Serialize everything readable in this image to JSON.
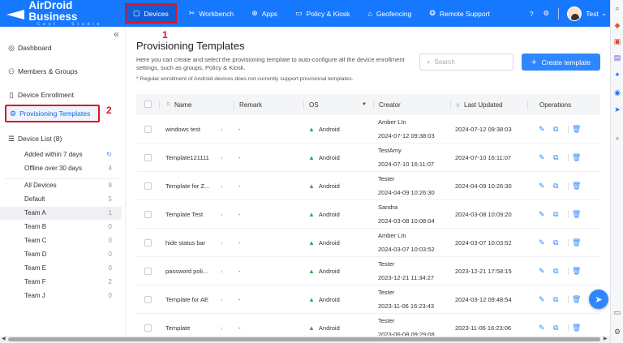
{
  "brand": {
    "name": "AirDroid Business",
    "tagline": "Cast · Studio"
  },
  "top_nav": [
    {
      "label": "Devices",
      "icon": "tablet-icon",
      "glyph": "▢"
    },
    {
      "label": "Workbench",
      "icon": "tools-icon",
      "glyph": "✂"
    },
    {
      "label": "Apps",
      "icon": "bag-icon",
      "glyph": "⊕"
    },
    {
      "label": "Policy & Kiosk",
      "icon": "folder-icon",
      "glyph": "▭"
    },
    {
      "label": "Geofencing",
      "icon": "map-pin-icon",
      "glyph": "⌂"
    },
    {
      "label": "Remote Support",
      "icon": "lifebuoy-icon",
      "glyph": "❂"
    }
  ],
  "user": {
    "name": "Test"
  },
  "annotations": {
    "one": "1",
    "two": "2"
  },
  "sidebar": {
    "dashboard": "Dashboard",
    "members": "Members & Groups",
    "enrollment": "Device Enrollment",
    "provisioning": "Provisioning Templates",
    "device_list": "Device List (8)",
    "filters": [
      {
        "label": "Added within 7 days",
        "count": ""
      },
      {
        "label": "Offline over 30 days",
        "count": "4"
      }
    ],
    "groups": [
      {
        "label": "All Devices",
        "count": "8"
      },
      {
        "label": "Default",
        "count": "5"
      },
      {
        "label": "Team A",
        "count": "1"
      },
      {
        "label": "Team B",
        "count": "0"
      },
      {
        "label": "Team C",
        "count": "0"
      },
      {
        "label": "Team D",
        "count": "0"
      },
      {
        "label": "Team E",
        "count": "0"
      },
      {
        "label": "Team F",
        "count": "2"
      },
      {
        "label": "Team J",
        "count": "0"
      }
    ]
  },
  "main": {
    "title": "Provisioning Templates",
    "description": "Here you can create and select the provisioning template to auto-configure all the device enrollment settings, such as groups, Policy & Kiosk.",
    "note": "* Regular enrollment of Android devices does not currently support provisional templates.",
    "search_placeholder": "Search",
    "create_label": "Create template"
  },
  "table": {
    "headers": {
      "name": "Name",
      "remark": "Remark",
      "os": "OS",
      "creator": "Creator",
      "updated": "Last Updated",
      "ops": "Operations"
    },
    "rows": [
      {
        "name": "windows test",
        "remark": "-",
        "os": "Android",
        "creator": "Amber LIn",
        "created": "2024-07-12 09:38:03",
        "updated": "2024-07-12 09:38:03"
      },
      {
        "name": "Template121111",
        "remark": "-",
        "os": "Android",
        "creator": "TestAmy",
        "created": "2024-07-10 16:11:07",
        "updated": "2024-07-10 16:11:07"
      },
      {
        "name": "Template for Z...",
        "remark": "-",
        "os": "Android",
        "creator": "Tester",
        "created": "2024-04-09 10:26:30",
        "updated": "2024-04-09 10:26:30"
      },
      {
        "name": "Template Test",
        "remark": "-",
        "os": "Android",
        "creator": "Sandra",
        "created": "2024-03-08 10:08:04",
        "updated": "2024-03-08 10:09:20"
      },
      {
        "name": "hide status bar",
        "remark": "-",
        "os": "Android",
        "creator": "Amber LIn",
        "created": "2024-03-07 10:03:52",
        "updated": "2024-03-07 10:03:52"
      },
      {
        "name": "password poli...",
        "remark": "-",
        "os": "Android",
        "creator": "Tester",
        "created": "2023-12-21 11:34:27",
        "updated": "2023-12-21 17:58:15"
      },
      {
        "name": "Template for AE",
        "remark": "-",
        "os": "Android",
        "creator": "Tester",
        "created": "2023-11-06 16:23:43",
        "updated": "2024-03-12 09:48:54"
      },
      {
        "name": "Template",
        "remark": "-",
        "os": "Android",
        "creator": "Tester",
        "created": "2023-06-08 09:29:08",
        "updated": "2023-11-06 16:23:06"
      }
    ]
  },
  "colors": {
    "brand_blue": "#1678ff",
    "highlight_red": "#e0141c",
    "android_green": "#3aa757"
  }
}
